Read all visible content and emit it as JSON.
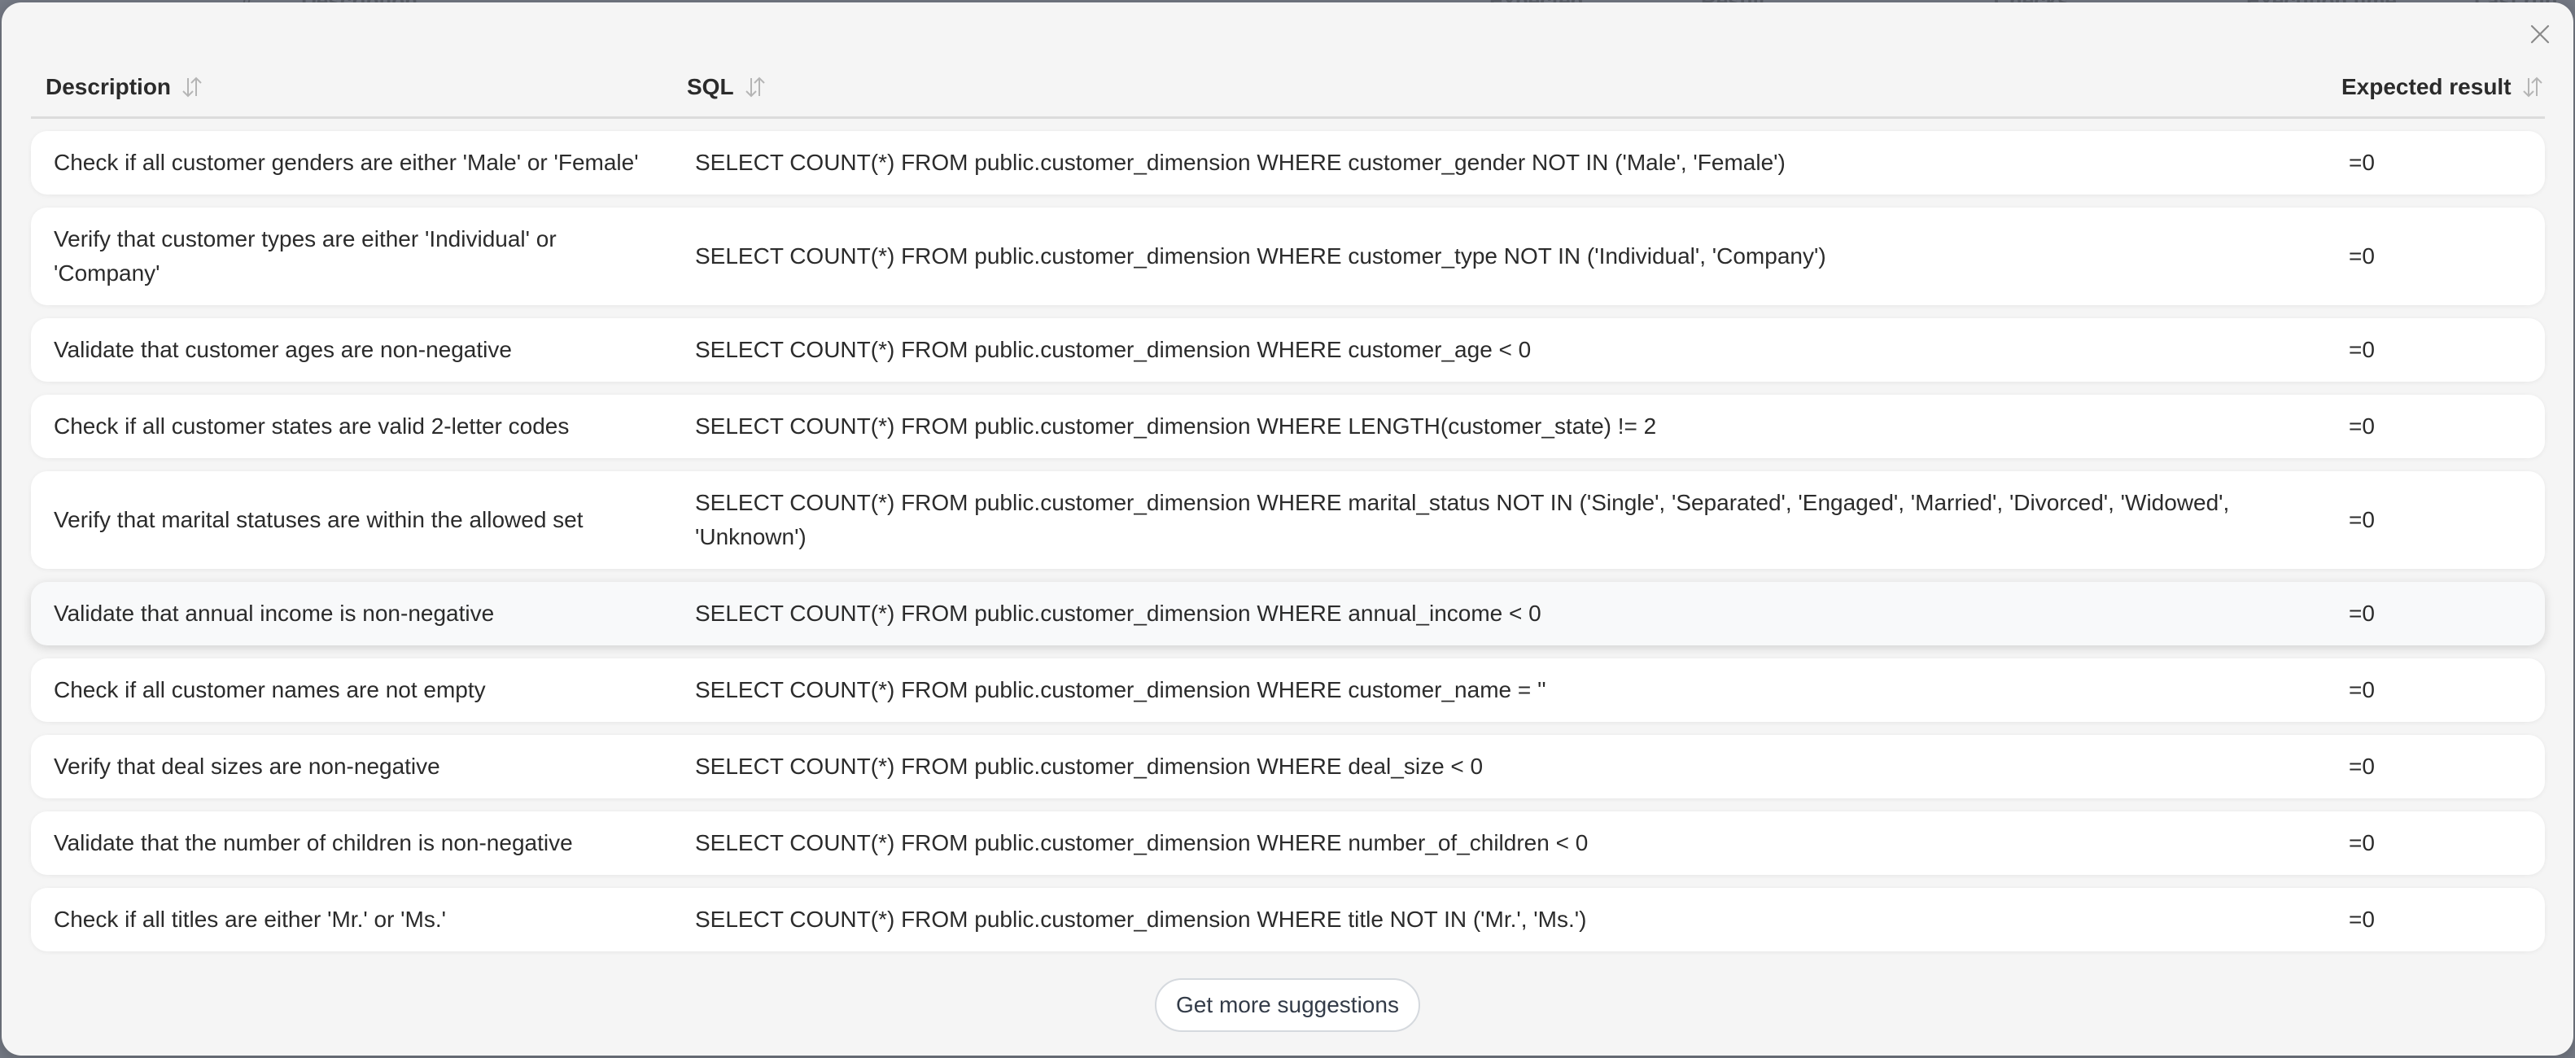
{
  "background": {
    "columns_visible": [
      "#",
      "Description",
      "Expected",
      "Result",
      "Checks",
      "Execution time",
      "Last run"
    ]
  },
  "modal": {
    "close_icon": "close-icon",
    "columns": [
      {
        "key": "description",
        "label": "Description",
        "sort_icon": "sort-icon"
      },
      {
        "key": "sql",
        "label": "SQL",
        "sort_icon": "sort-icon"
      },
      {
        "key": "expected_result",
        "label": "Expected result",
        "sort_icon": "sort-icon"
      }
    ],
    "rows": [
      {
        "description": "Check if all customer genders are either 'Male' or 'Female'",
        "sql": "SELECT COUNT(*) FROM public.customer_dimension WHERE customer_gender NOT IN ('Male', 'Female')",
        "expected_result": "=0"
      },
      {
        "description": "Verify that customer types are either 'Individual' or 'Company'",
        "sql": "SELECT COUNT(*) FROM public.customer_dimension WHERE customer_type NOT IN ('Individual', 'Company')",
        "expected_result": "=0"
      },
      {
        "description": "Validate that customer ages are non-negative",
        "sql": "SELECT COUNT(*) FROM public.customer_dimension WHERE customer_age < 0",
        "expected_result": "=0"
      },
      {
        "description": "Check if all customer states are valid 2-letter codes",
        "sql": "SELECT COUNT(*) FROM public.customer_dimension WHERE LENGTH(customer_state) != 2",
        "expected_result": "=0"
      },
      {
        "description": "Verify that marital statuses are within the allowed set",
        "sql": "SELECT COUNT(*) FROM public.customer_dimension WHERE marital_status NOT IN ('Single', 'Separated', 'Engaged', 'Married', 'Divorced', 'Widowed', 'Unknown')",
        "expected_result": "=0"
      },
      {
        "description": "Validate that annual income is non-negative",
        "sql": "SELECT COUNT(*) FROM public.customer_dimension WHERE annual_income < 0",
        "expected_result": "=0",
        "hovered": true
      },
      {
        "description": "Check if all customer names are not empty",
        "sql": "SELECT COUNT(*) FROM public.customer_dimension WHERE customer_name = ''",
        "expected_result": "=0"
      },
      {
        "description": "Verify that deal sizes are non-negative",
        "sql": "SELECT COUNT(*) FROM public.customer_dimension WHERE deal_size < 0",
        "expected_result": "=0"
      },
      {
        "description": "Validate that the number of children is non-negative",
        "sql": "SELECT COUNT(*) FROM public.customer_dimension WHERE number_of_children < 0",
        "expected_result": "=0"
      },
      {
        "description": "Check if all titles are either 'Mr.' or 'Ms.'",
        "sql": "SELECT COUNT(*) FROM public.customer_dimension WHERE title NOT IN ('Mr.', 'Ms.')",
        "expected_result": "=0"
      }
    ],
    "more_button_label": "Get more suggestions"
  },
  "colors": {
    "modal_bg": "#f5f5f5",
    "row_bg": "#ffffff",
    "row_hover_bg": "#f8f9fa",
    "text": "#2b2b2b",
    "sort_icon": "#b5b5b5",
    "overlay": "#767b86"
  }
}
